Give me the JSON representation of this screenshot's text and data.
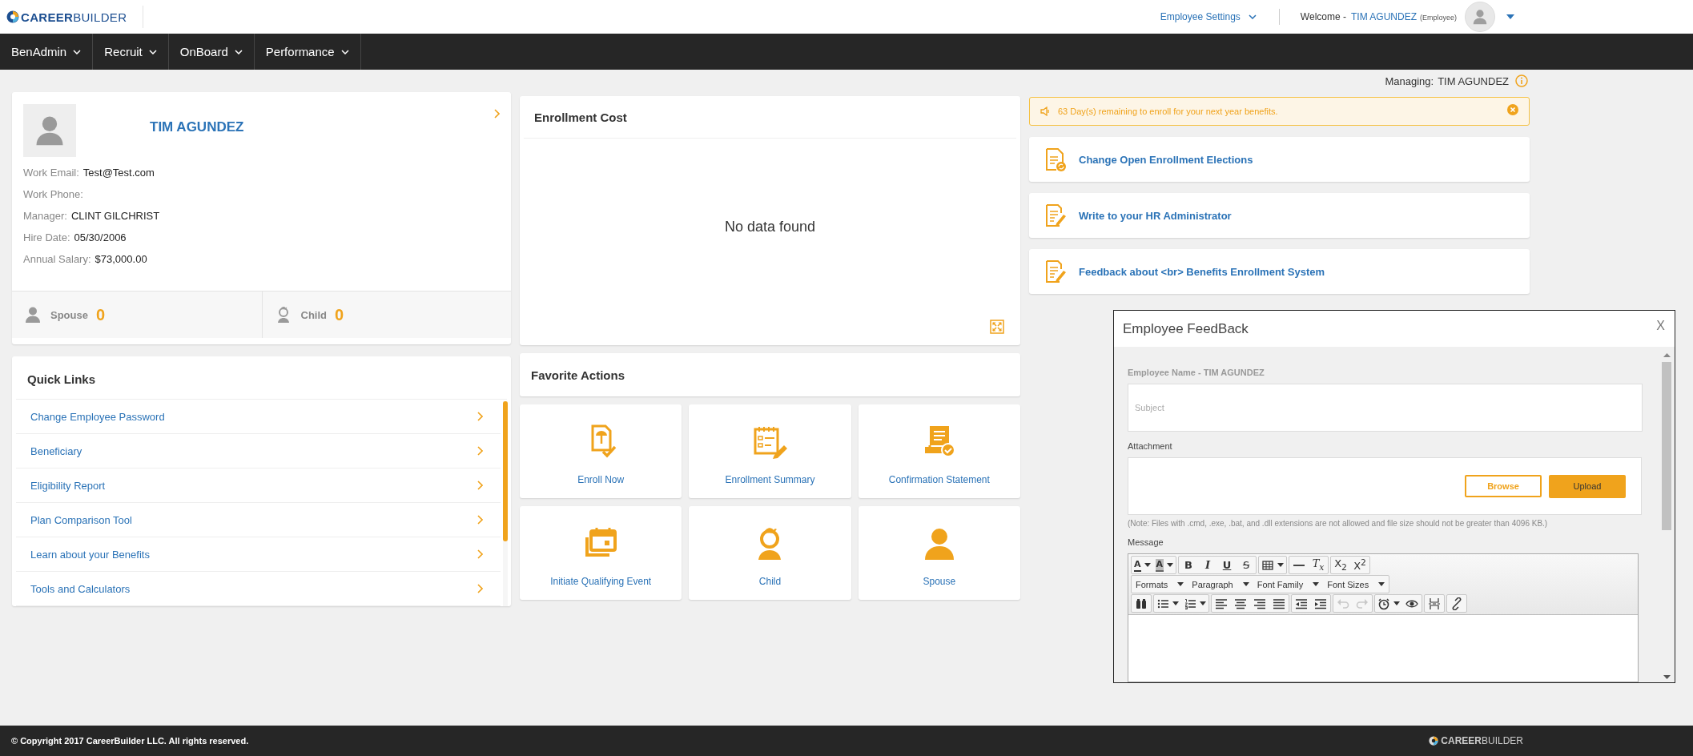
{
  "header": {
    "logo": "**CAREER**BUILDER",
    "settings_menu": "Employee Settings",
    "welcome_label": "Welcome -",
    "user_name": "TIM AGUNDEZ",
    "user_role": "(Employee)"
  },
  "nav": {
    "items": [
      "BenAdmin",
      "Recruit",
      "OnBoard",
      "Performance"
    ]
  },
  "managing": {
    "label": "Managing:",
    "name": "TIM AGUNDEZ"
  },
  "profile": {
    "name": "TIM AGUNDEZ",
    "fields": [
      {
        "label": "Work Email:",
        "value": "Test@Test.com"
      },
      {
        "label": "Work Phone:"
      },
      {
        "label": "Manager:",
        "value": "CLINT GILCHRIST"
      },
      {
        "label": "Hire Date:",
        "value": "05/30/2006"
      },
      {
        "label": "Annual Salary:",
        "value": "$73,000.00"
      }
    ],
    "dependents": [
      {
        "kind": "spouse",
        "label": "Spouse",
        "count": "0"
      },
      {
        "kind": "child",
        "label": "Child",
        "count": "0"
      }
    ]
  },
  "quick_links": {
    "title": "Quick Links",
    "items": [
      "Change Employee Password",
      "Beneficiary",
      "Eligibility Report",
      "Plan Comparison Tool",
      "Learn about your Benefits",
      "Tools and Calculators"
    ]
  },
  "enrollment_cost": {
    "title": "Enrollment Cost",
    "message": "No data found"
  },
  "favorite_actions": {
    "title": "Favorite Actions",
    "tiles": [
      {
        "kind": "enroll",
        "label": "Enroll Now"
      },
      {
        "kind": "summary",
        "label": "Enrollment Summary"
      },
      {
        "kind": "confirmation",
        "label": "Confirmation Statement"
      },
      {
        "kind": "event",
        "label": "Initiate Qualifying Event"
      },
      {
        "kind": "child",
        "label": "Child"
      },
      {
        "kind": "spouse",
        "label": "Spouse"
      }
    ]
  },
  "banner": {
    "text": "63 Day(s) remaining to enroll for your next year benefits."
  },
  "action_cards": [
    {
      "kind": "elections",
      "label": "Change Open Enrollment Elections"
    },
    {
      "kind": "write",
      "label": "Write to your HR Administrator"
    },
    {
      "kind": "feedback",
      "label": "Feedback about <br> Benefits Enrollment System"
    }
  ],
  "feedback_dialog": {
    "title": "Employee FeedBack",
    "close": "X",
    "employee_label": "Employee Name - TIM AGUNDEZ",
    "subject": {
      "placeholder": "Subject"
    },
    "attachment_label": "Attachment",
    "browse_button": "Browse",
    "upload_button": "Upload",
    "note": "(Note: Files with .cmd, .exe, .bat, and .dll extensions are not allowed and file size should not be greater than 4096 KB.)",
    "message_label": "Message",
    "toolbar": [
      [
        [
          {
            "kind": "text-color",
            "label": "A",
            "caret": true,
            "disabled": false
          },
          {
            "kind": "background-color",
            "label": "A",
            "caret": true,
            "disabled": false
          }
        ],
        [
          {
            "kind": "bold",
            "label": "B",
            "caret": false,
            "disabled": false
          },
          {
            "kind": "italic",
            "label": "I",
            "caret": false,
            "disabled": false
          },
          {
            "kind": "underline",
            "label": "U",
            "caret": false,
            "disabled": false
          },
          {
            "kind": "strikethrough",
            "label": "S",
            "caret": false,
            "disabled": false
          }
        ],
        [
          {
            "kind": "table",
            "caret": true,
            "disabled": false
          }
        ],
        [
          {
            "kind": "horizontal-rule",
            "caret": false,
            "disabled": false
          },
          {
            "kind": "clear-formatting",
            "label": "T$_{x}$",
            "caret": false,
            "disabled": false
          }
        ],
        [
          {
            "kind": "subscript",
            "label": "X$_{2}$",
            "caret": false,
            "disabled": false
          },
          {
            "kind": "superscript",
            "label": "X$^{2}$",
            "caret": false,
            "disabled": false
          }
        ]
      ],
      [
        [
          {
            "kind": "select",
            "label": "Formats",
            "caret": true,
            "disabled": false
          },
          {
            "kind": "select",
            "label": "Paragraph",
            "caret": true,
            "disabled": false
          },
          {
            "kind": "select",
            "label": "Font Family",
            "caret": true,
            "disabled": false
          },
          {
            "kind": "select",
            "label": "Font Sizes",
            "caret": true,
            "disabled": false
          }
        ]
      ],
      [
        [
          {
            "kind": "find",
            "caret": false,
            "disabled": false
          }
        ],
        [
          {
            "kind": "bullet-list",
            "caret": true,
            "disabled": false
          },
          {
            "kind": "numbered-list",
            "caret": true,
            "disabled": false
          }
        ],
        [
          {
            "kind": "align-left",
            "caret": false,
            "disabled": false
          },
          {
            "kind": "align-center",
            "caret": false,
            "disabled": false
          },
          {
            "kind": "align-right",
            "caret": false,
            "disabled": false
          },
          {
            "kind": "justify",
            "caret": false,
            "disabled": false
          }
        ],
        [
          {
            "kind": "outdent",
            "caret": false,
            "disabled": false
          },
          {
            "kind": "indent",
            "caret": false,
            "disabled": false
          }
        ],
        [
          {
            "kind": "undo",
            "caret": false,
            "disabled": true
          },
          {
            "kind": "redo",
            "caret": false,
            "disabled": true
          }
        ],
        [
          {
            "kind": "clock",
            "caret": true,
            "disabled": false
          },
          {
            "kind": "preview",
            "caret": false,
            "disabled": false
          }
        ],
        [
          {
            "kind": "page-break",
            "caret": false,
            "disabled": false
          }
        ],
        [
          {
            "kind": "link",
            "caret": false,
            "disabled": false
          }
        ]
      ]
    ]
  },
  "footer": {
    "copyright": "© Copyright 2017 CareerBuilder LLC. All rights reserved.",
    "logo": "**CAREER**BUILDER"
  }
}
